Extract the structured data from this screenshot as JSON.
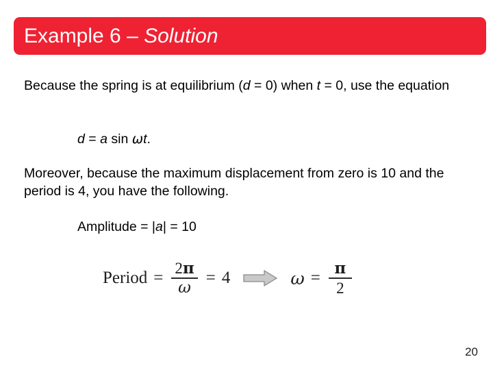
{
  "slide": {
    "title": {
      "main": "Example 6 – ",
      "emphasis": "Solution",
      "banner_color": "#ee2233",
      "text_color": "#ffffff"
    },
    "page_number": "20",
    "body": {
      "paragraph_1": {
        "before_d": "Because the spring is at equilibrium (",
        "var_d": "d",
        "between": " = 0) when ",
        "var_t": "t",
        "after_t": " = 0, use the equation"
      },
      "equation_line": {
        "var_d": "d",
        "eq1": " = ",
        "var_a": "a",
        "sin": " sin ",
        "omega": "ω",
        "var_t": "t",
        "period": "."
      },
      "paragraph_2": "Moreover, because the maximum displacement from zero is 10 and the period is 4, you have the following.",
      "amplitude_line": {
        "label": "Amplitude = |",
        "var_a": "a",
        "value": "| = 10"
      }
    },
    "formula": {
      "period_label": "Period",
      "equals_1": "=",
      "fraction_1": {
        "numerator_coefficient": "2",
        "numerator_symbol": "π",
        "denominator": "ω"
      },
      "equals_2": "=",
      "period_value": "4",
      "arrow": "right-block-arrow",
      "arrow_fill": "#c9c9c9",
      "arrow_stroke": "#8a8a8a",
      "omega_label": "ω",
      "equals_3": "=",
      "fraction_2": {
        "numerator": "π",
        "denominator": "2"
      }
    }
  }
}
